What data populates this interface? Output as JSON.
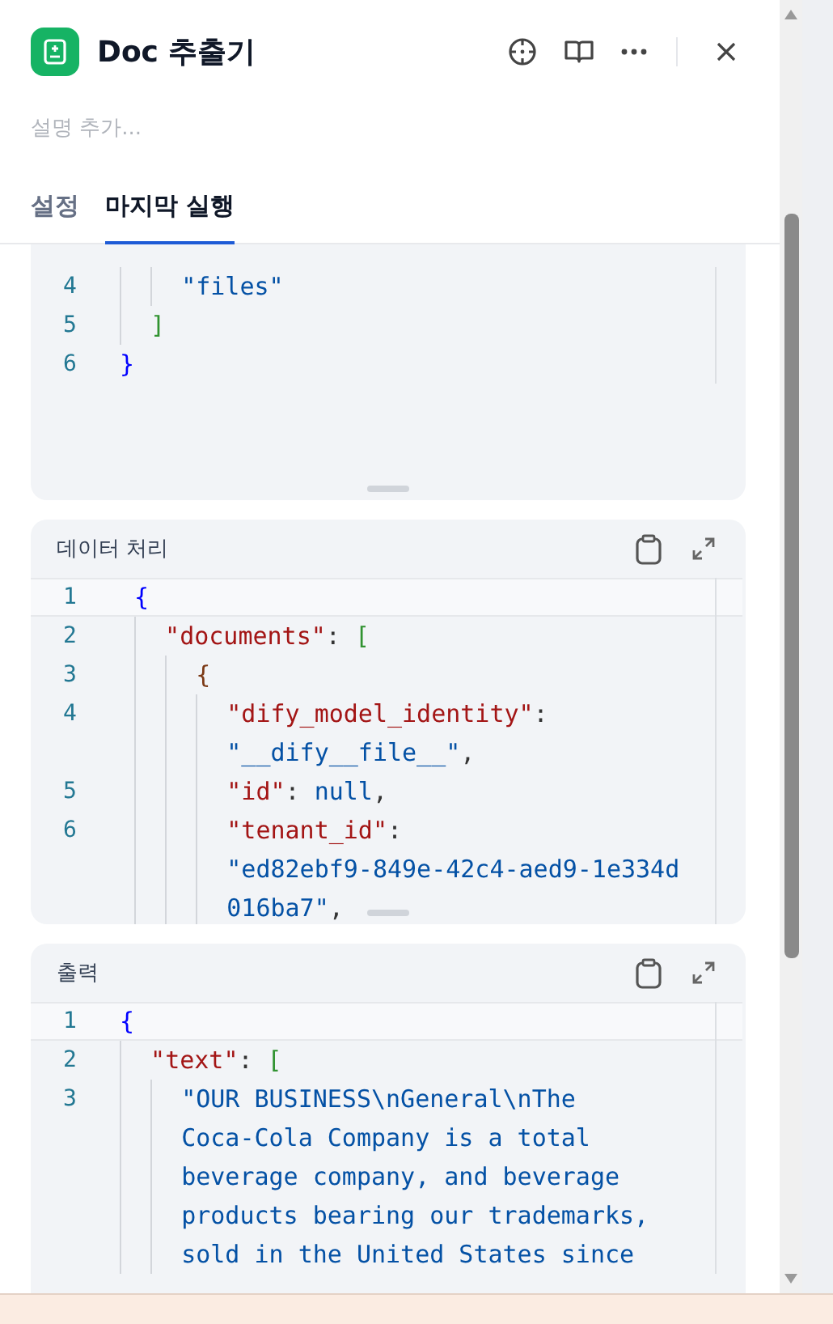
{
  "header": {
    "title": "Doc 추출기",
    "description_placeholder": "설명 추가..."
  },
  "tabs": [
    {
      "label": "설정",
      "selected": false
    },
    {
      "label": "마지막 실행",
      "selected": true
    }
  ],
  "panels": [
    {
      "rows": [
        {
          "number": "4",
          "indent": "    ",
          "active": false,
          "tokens": [
            {
              "text": "\"files\"",
              "kind": "string"
            }
          ]
        },
        {
          "number": "5",
          "indent": "  ",
          "active": false,
          "tokens": [
            {
              "text": "]",
              "kind": "bracket"
            }
          ]
        },
        {
          "number": "6",
          "indent": "",
          "active": false,
          "tokens": [
            {
              "text": "}",
              "kind": "brace"
            }
          ]
        }
      ]
    },
    {
      "title": "데이터 처리",
      "rows": [
        {
          "number": "1",
          "indent": "",
          "active": true,
          "tokens": [
            {
              "text": "{",
              "kind": "brace"
            }
          ]
        },
        {
          "number": "2",
          "indent": "  ",
          "active": false,
          "tokens": [
            {
              "text": "\"documents\"",
              "kind": "key"
            },
            {
              "text": ": ",
              "kind": "punct"
            },
            {
              "text": "[",
              "kind": "bracket"
            }
          ]
        },
        {
          "number": "3",
          "indent": "    ",
          "active": false,
          "tokens": [
            {
              "text": "{",
              "kind": "inner"
            }
          ]
        },
        {
          "number": "4",
          "indent": "      ",
          "active": false,
          "tokens": [
            {
              "text": "\"dify_model_identity\"",
              "kind": "key"
            },
            {
              "text": ":",
              "kind": "punct"
            }
          ]
        },
        {
          "indent": "      ",
          "active": false,
          "tokens": [
            {
              "text": "\"__dify__file__\"",
              "kind": "string"
            },
            {
              "text": ",",
              "kind": "punct"
            }
          ]
        },
        {
          "number": "5",
          "indent": "      ",
          "active": false,
          "tokens": [
            {
              "text": "\"id\"",
              "kind": "key"
            },
            {
              "text": ": ",
              "kind": "punct"
            },
            {
              "text": "null",
              "kind": "string"
            },
            {
              "text": ",",
              "kind": "punct"
            }
          ]
        },
        {
          "number": "6",
          "indent": "      ",
          "active": false,
          "tokens": [
            {
              "text": "\"tenant_id\"",
              "kind": "key"
            },
            {
              "text": ":",
              "kind": "punct"
            }
          ]
        },
        {
          "indent": "      ",
          "active": false,
          "tokens": [
            {
              "text": "\"ed82ebf9-849e-42c4-aed9-1e334d",
              "kind": "string"
            }
          ]
        },
        {
          "indent": "      ",
          "active": false,
          "tokens": [
            {
              "text": "016ba7\"",
              "kind": "string"
            },
            {
              "text": ",",
              "kind": "punct"
            }
          ]
        }
      ]
    },
    {
      "title": "출력",
      "rows": [
        {
          "number": "1",
          "indent": "",
          "active": true,
          "tokens": [
            {
              "text": "{",
              "kind": "brace"
            }
          ]
        },
        {
          "number": "2",
          "indent": "  ",
          "active": false,
          "tokens": [
            {
              "text": "\"text\"",
              "kind": "key"
            },
            {
              "text": ": ",
              "kind": "punct"
            },
            {
              "text": "[",
              "kind": "bracket"
            }
          ]
        },
        {
          "number": "3",
          "indent": "    ",
          "active": false,
          "tokens": [
            {
              "text": "\"OUR BUSINESS\\nGeneral\\nThe",
              "kind": "string"
            }
          ]
        },
        {
          "indent": "    ",
          "active": false,
          "tokens": [
            {
              "text": "Coca-Cola Company is a total",
              "kind": "string"
            }
          ]
        },
        {
          "indent": "    ",
          "active": false,
          "tokens": [
            {
              "text": "beverage company, and beverage",
              "kind": "string"
            }
          ]
        },
        {
          "indent": "    ",
          "active": false,
          "tokens": [
            {
              "text": "products bearing our trademarks,",
              "kind": "string"
            }
          ]
        },
        {
          "indent": "    ",
          "active": false,
          "tokens": [
            {
              "text": "sold in the United States since",
              "kind": "string"
            }
          ]
        }
      ]
    }
  ]
}
